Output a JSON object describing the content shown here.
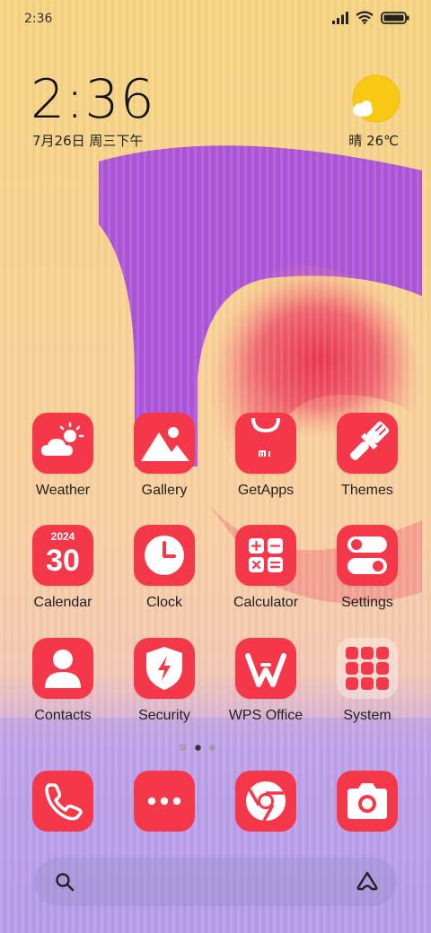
{
  "status_bar": {
    "time": "2:36",
    "icons": [
      "signal-icon",
      "wifi-icon",
      "battery-icon"
    ]
  },
  "clock_widget": {
    "time": "2:36",
    "date": "7月26日 周三下午"
  },
  "weather_widget": {
    "icon": "sun-cloud-icon",
    "text": "晴 26℃"
  },
  "apps": [
    {
      "label": "Weather",
      "icon": "weather-icon"
    },
    {
      "label": "Gallery",
      "icon": "gallery-icon"
    },
    {
      "label": "GetApps",
      "icon": "getapps-bag-icon"
    },
    {
      "label": "Themes",
      "icon": "paintbrush-icon"
    },
    {
      "label": "Calendar",
      "icon": "calendar-icon",
      "year": "2024",
      "day": "30"
    },
    {
      "label": "Clock",
      "icon": "clock-icon"
    },
    {
      "label": "Calculator",
      "icon": "calculator-icon"
    },
    {
      "label": "Settings",
      "icon": "toggles-icon"
    },
    {
      "label": "Contacts",
      "icon": "person-icon"
    },
    {
      "label": "Security",
      "icon": "shield-bolt-icon"
    },
    {
      "label": "WPS Office",
      "icon": "wps-icon"
    },
    {
      "label": "System",
      "icon": "folder-icon"
    }
  ],
  "page_indicator": {
    "pages": 3,
    "current": 2
  },
  "dock": [
    {
      "name": "phone",
      "icon": "phone-icon"
    },
    {
      "name": "messages",
      "icon": "more-dots-icon"
    },
    {
      "name": "browser",
      "icon": "chrome-icon"
    },
    {
      "name": "camera",
      "icon": "camera-icon"
    }
  ],
  "search_bar": {
    "left_icon": "search-icon",
    "right_icon": "assistant-icon"
  },
  "colors": {
    "accent": "#f5374a",
    "wallpaper_top": "#f7d27a",
    "wallpaper_purple": "#a24be0",
    "wallpaper_bottom": "#b69ae6"
  }
}
